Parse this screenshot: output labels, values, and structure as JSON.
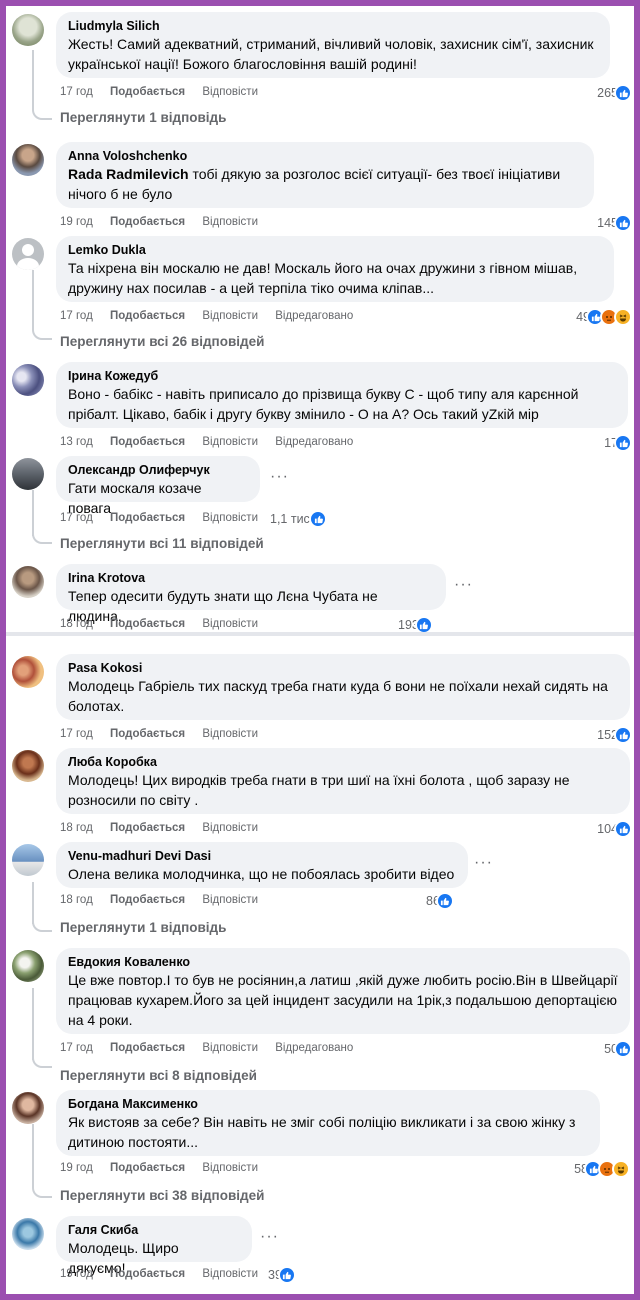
{
  "meta": {
    "like": "Подобається",
    "reply": "Відповісти",
    "edited": "Відредаговано"
  },
  "colors": {
    "frame": "#9b4fb0",
    "like": "#1877f2"
  },
  "comments": [
    {
      "author": "Liudmyla Silich",
      "text": "Жесть! Самий адекватний, стриманий, вічливий чоловік, захисник сім'ї, захисник української нації! Божого благословіння вашій родині!",
      "time": "17 год",
      "reactions": "265",
      "view_replies": "Переглянути 1 відповідь"
    },
    {
      "author": "Anna Voloshchenko",
      "mention": "Rada Radmilevich",
      "text": " тобі дякую за розголос всієї ситуації- без твоєї ініціативи нічого б не було",
      "time": "19 год",
      "reactions": "145"
    },
    {
      "author": "Lemko Dukla",
      "text": "Та ніхрена він москалю не дав! Москаль його на очах дружини з гівном мішав, дружину нах посилав - а цей терпіла тіко очима кліпав...",
      "time": "17 год",
      "edited": true,
      "reactions": "49",
      "view_replies": "Переглянути всі 26 відповідей"
    },
    {
      "author": "Ірина Кожедуб",
      "text": "Воно - бабікс - навіть приписало до прізвища букву С - щоб типу аля карєнной прібалт. Цікаво, бабік і другу букву змінило - О на А? Ось такий уZкій мір",
      "time": "13 год",
      "edited": true,
      "reactions": "17"
    },
    {
      "author": "Олександр Олиферчук",
      "text": "Гати москаля козаче повага",
      "time": "17 год",
      "reactions": "1,1 тис.",
      "view_replies": "Переглянути всі 11 відповідей"
    },
    {
      "author": "Irina Krotova",
      "text": "Тепер одесити будуть знати що Лєна Чубата не людина.",
      "time": "18 год",
      "reactions": "193"
    },
    {
      "author": "Pasa Kokosi",
      "text": "Молодець Габріель тих паскуд треба гнати куда б вони не поїхали нехай сидять на болотах.",
      "time": "17 год",
      "reactions": "152"
    },
    {
      "author": "Люба Коробка",
      "text": "Молодець! Цих виродків треба гнати в три шиї на їхні болота , щоб заразу не розносили по світу .",
      "time": "18 год",
      "reactions": "104"
    },
    {
      "author": "Venu-madhuri Devi Dasi",
      "text": "Олена велика молодчинка, що не побоялась зробити відео",
      "time": "18 год",
      "reactions": "86",
      "view_replies": "Переглянути 1 відповідь"
    },
    {
      "author": "Евдокия Коваленко",
      "text": "Це вже повтор.І то був не росіянин,а латиш ,якій дуже любить росію.Він в Швейцарії працював кухарем.Його за цей інцидент засудили на 1рік,з подальшою депортацією на 4 роки.",
      "time": "17 год",
      "edited": true,
      "reactions": "50",
      "view_replies": "Переглянути всі 8 відповідей"
    },
    {
      "author": "Богдана Максименко",
      "text": "Як вистояв за себе? Він навіть не зміг собі поліцію викликати і за свою жінку з дитиною постояти...",
      "time": "19 год",
      "reactions": "58",
      "view_replies": "Переглянути всі 38 відповідей"
    },
    {
      "author": "Галя Скиба",
      "text": "Молодець. Щиро дякуємо!",
      "time": "19 год",
      "reactions": "39"
    }
  ]
}
